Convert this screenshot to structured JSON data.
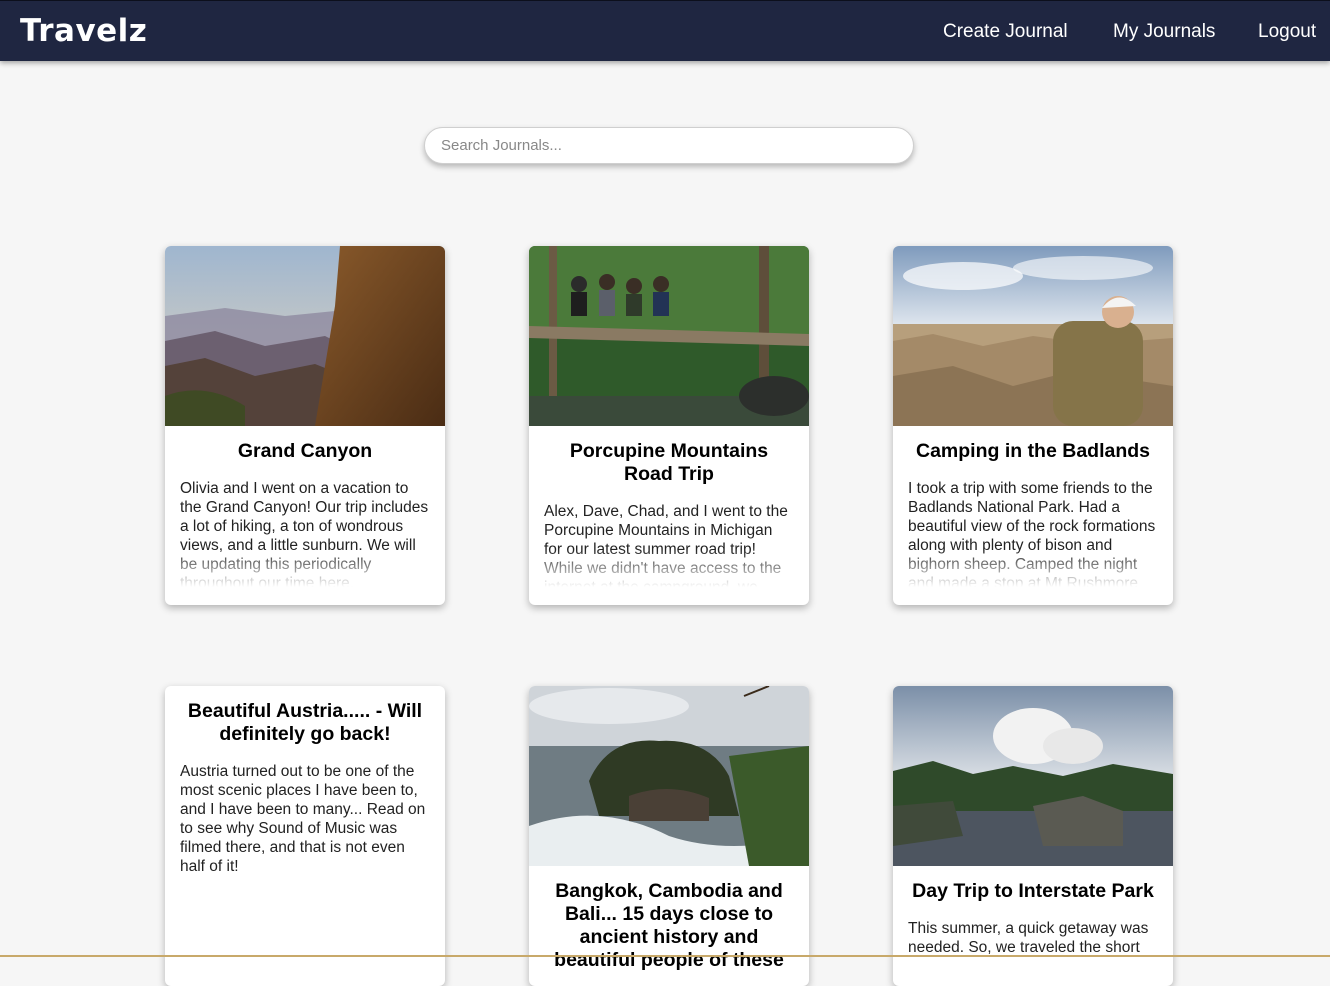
{
  "header": {
    "brand": "Travelz",
    "nav": {
      "create": "Create Journal",
      "mine": "My Journals",
      "logout": "Logout"
    }
  },
  "search": {
    "placeholder": "Search Journals..."
  },
  "journals": [
    {
      "title": "Grand Canyon",
      "excerpt": "Olivia and I went on a vacation to the Grand Canyon! Our trip includes a lot of hiking, a ton of wondrous views, and a little sunburn. We will be updating this periodically throughout our time here."
    },
    {
      "title": "Porcupine Mountains Road Trip",
      "excerpt": "Alex, Dave, Chad, and I went to the Porcupine Mountains in Michigan for our latest summer road trip! While we didn't have access to the internet at the campground, we"
    },
    {
      "title": "Camping in the Badlands",
      "excerpt": "I took a trip with some friends to the Badlands National Park. Had a beautiful view of the rock formations along with plenty of bison and bighorn sheep. Camped the night and made a stop at Mt Rushmore"
    },
    {
      "title": "Beautiful Austria..... - Will definitely go back!",
      "excerpt": "Austria turned out to be one of the most scenic places I have been to, and I have been to many... Read on to see why Sound of Music was filmed there, and that is not even half of it!"
    },
    {
      "title": "Bangkok, Cambodia and Bali... 15 days close to ancient history and beautiful people of these",
      "excerpt": ""
    },
    {
      "title": "Day Trip to Interstate Park",
      "excerpt": "This summer, a quick getaway was needed. So, we traveled the short"
    }
  ]
}
